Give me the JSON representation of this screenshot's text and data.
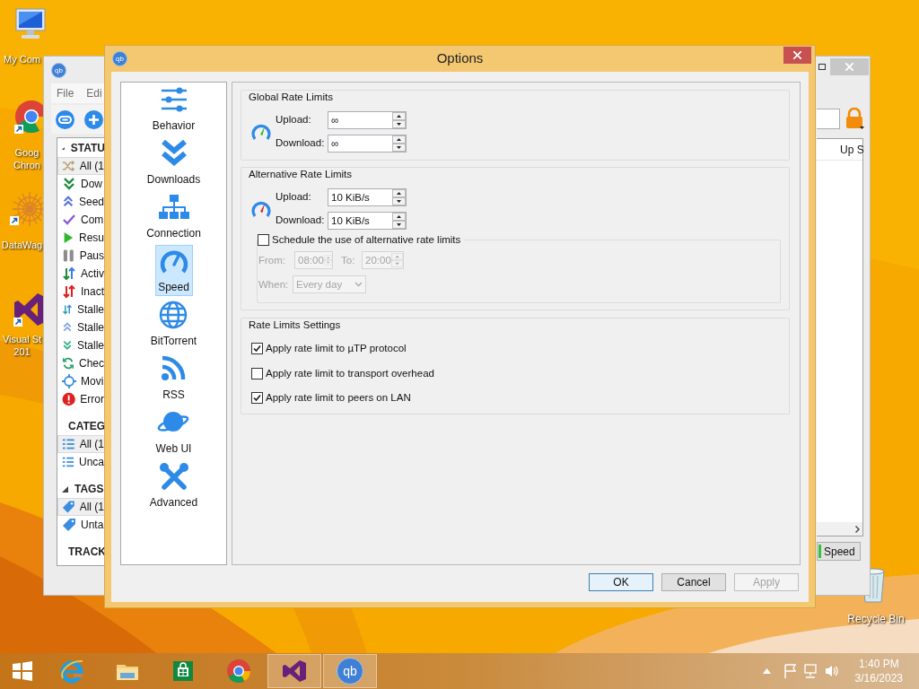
{
  "desktop_icons": [
    {
      "label": "My Com"
    },
    {
      "label": "Goog\nChron"
    },
    {
      "label": "DataWag"
    },
    {
      "label": "Visual St\n201"
    },
    {
      "label": "Recycle Bin"
    }
  ],
  "main_window": {
    "logo_text": "qb",
    "menu": [
      "File",
      "Edi"
    ],
    "sidebar": [
      {
        "kind": "status",
        "title": "STATU",
        "items": [
          {
            "label": "All (1",
            "selected": true
          },
          {
            "label": "Dow",
            "selected": false
          },
          {
            "label": "Seed",
            "selected": false
          },
          {
            "label": "Com",
            "selected": false
          },
          {
            "label": "Resu",
            "selected": false
          },
          {
            "label": "Paus",
            "selected": false
          },
          {
            "label": "Activ",
            "selected": false
          },
          {
            "label": "Inact",
            "selected": false
          },
          {
            "label": "Stalle",
            "selected": false
          },
          {
            "label": "Stalle",
            "selected": false
          },
          {
            "label": "Stalle",
            "selected": false
          },
          {
            "label": "Chec",
            "selected": false
          },
          {
            "label": "Movi",
            "selected": false
          },
          {
            "label": "Error",
            "selected": false
          }
        ]
      },
      {
        "kind": "categories",
        "title": "CATEG",
        "items": [
          {
            "label": "All (1",
            "selected": true
          },
          {
            "label": "Unca",
            "selected": false
          }
        ]
      },
      {
        "kind": "tags",
        "title": "TAGS",
        "items": [
          {
            "label": "All (1",
            "selected": true
          },
          {
            "label": "Unta",
            "selected": false
          }
        ]
      },
      {
        "kind": "trackers",
        "title": "TRACK"
      }
    ],
    "column_header": "Up S",
    "status_button": "Speed"
  },
  "options_dialog": {
    "logo_text": "qb",
    "title": "Options",
    "categories": [
      {
        "label": "Behavior",
        "selected": false
      },
      {
        "label": "Downloads",
        "selected": false
      },
      {
        "label": "Connection",
        "selected": false
      },
      {
        "label": "Speed",
        "selected": true
      },
      {
        "label": "BitTorrent",
        "selected": false
      },
      {
        "label": "RSS",
        "selected": false
      },
      {
        "label": "Web UI",
        "selected": false
      },
      {
        "label": "Advanced",
        "selected": false
      }
    ],
    "global_rate_limits": {
      "title": "Global Rate Limits",
      "upload_label": "Upload:",
      "upload": "∞",
      "download_label": "Download:",
      "download": "∞"
    },
    "alternative_rate_limits": {
      "title": "Alternative Rate Limits",
      "upload_label": "Upload:",
      "upload": "10 KiB/s",
      "download_label": "Download:",
      "download": "10 KiB/s",
      "schedule": {
        "label": "Schedule the use of alternative rate limits",
        "checked": false,
        "from_label": "From:",
        "from": "08:00",
        "to_label": "To:",
        "to": "20:00",
        "when_label": "When:",
        "when": "Every day"
      }
    },
    "rate_limits_settings": {
      "title": "Rate Limits Settings",
      "options": [
        {
          "label": "Apply rate limit to µTP protocol",
          "checked": true
        },
        {
          "label": "Apply rate limit to transport overhead",
          "checked": false
        },
        {
          "label": "Apply rate limit to peers on LAN",
          "checked": true
        }
      ]
    },
    "buttons": [
      {
        "label": "OK",
        "kind": "default",
        "disabled": false
      },
      {
        "label": "Cancel",
        "kind": "normal",
        "disabled": false
      },
      {
        "label": "Apply",
        "kind": "normal",
        "disabled": true
      }
    ]
  },
  "taskbar": {
    "apps": [
      {
        "active": false
      },
      {
        "active": false
      },
      {
        "active": false
      },
      {
        "active": false
      },
      {
        "active": true
      },
      {
        "active": true,
        "logo_text": "qb"
      }
    ],
    "time": "1:40 PM",
    "date": "3/16/2023"
  }
}
